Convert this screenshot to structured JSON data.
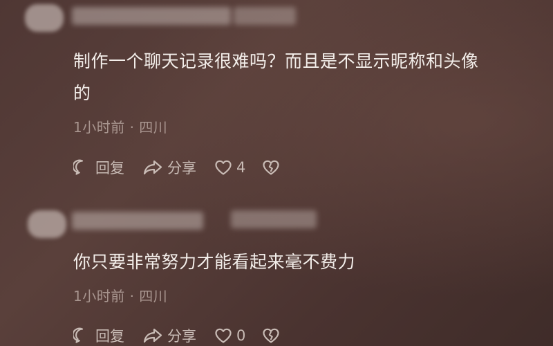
{
  "comments": [
    {
      "text_line1": "制作一个聊天记录很难吗？而且是不显示昵称和头像",
      "text_line2": "的",
      "meta": "1小时前 · 四川",
      "reply_label": "回复",
      "share_label": "分享",
      "like_count": "4"
    },
    {
      "text_line1": "你只要非常努力才能看起来毫不费力",
      "meta": "1小时前 · 四川",
      "reply_label": "回复",
      "share_label": "分享",
      "like_count": "0"
    }
  ],
  "colors": {
    "background": "#533a36",
    "text": "#f3eeea",
    "meta": "#a8958f",
    "actions": "#c9bcb6"
  },
  "icons": [
    "reply-icon",
    "share-icon",
    "like-icon",
    "dislike-icon"
  ]
}
